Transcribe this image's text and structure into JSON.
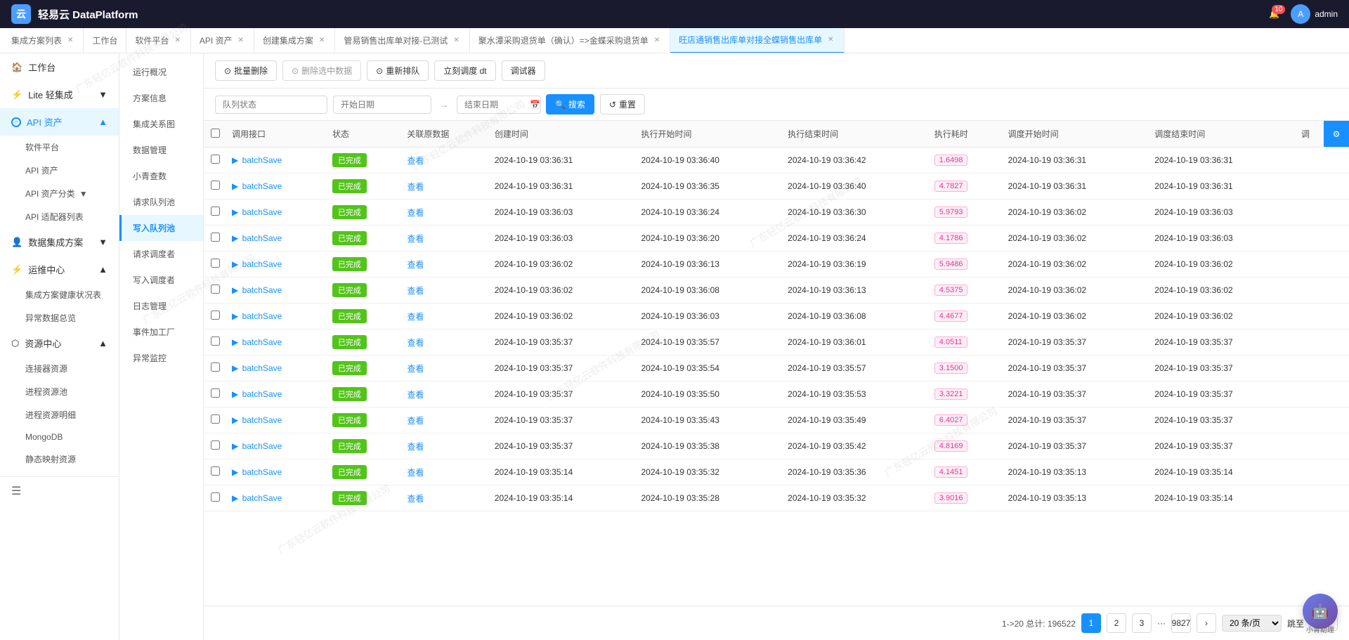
{
  "topbar": {
    "logo_text": "云",
    "title": "轻易云 DataPlatform",
    "notification_count": "10",
    "user_name": "admin"
  },
  "tabs": [
    {
      "id": "tab-solution-list",
      "label": "集成方案列表",
      "closable": true,
      "active": false
    },
    {
      "id": "tab-workbench",
      "label": "工作台",
      "closable": false,
      "active": false
    },
    {
      "id": "tab-software",
      "label": "软件平台",
      "closable": true,
      "active": false
    },
    {
      "id": "tab-api",
      "label": "API 资产",
      "closable": true,
      "active": false
    },
    {
      "id": "tab-create",
      "label": "创建集成方案",
      "closable": true,
      "active": false
    },
    {
      "id": "tab-sales",
      "label": "管易销售出库单对接-已测试",
      "closable": true,
      "active": false
    },
    {
      "id": "tab-purchase",
      "label": "聚水潭采购退货单（确认）=>金蝶采购退货单",
      "closable": true,
      "active": false
    },
    {
      "id": "tab-active",
      "label": "旺店通销售出库单对接全蝶销售出库单",
      "closable": true,
      "active": true
    }
  ],
  "sidebar": {
    "items": [
      {
        "id": "workbench",
        "label": "工作台",
        "icon": "🏠",
        "active": false,
        "expandable": false
      },
      {
        "id": "lite",
        "label": "Lite 轻集成",
        "icon": "⚡",
        "active": false,
        "expandable": true
      },
      {
        "id": "api-assets",
        "label": "API 资产",
        "icon": "○",
        "active": true,
        "expandable": true,
        "circle": true
      },
      {
        "id": "software-platform",
        "label": "软件平台",
        "sub": true,
        "active": false
      },
      {
        "id": "api-assets-sub",
        "label": "API 资产",
        "sub": true,
        "active": false
      },
      {
        "id": "api-classify",
        "label": "API 资产分类",
        "sub": true,
        "active": false,
        "expandable": true
      },
      {
        "id": "api-adapter",
        "label": "API 适配器列表",
        "sub": true,
        "active": false
      },
      {
        "id": "data-integration",
        "label": "数据集成方案",
        "icon": "👤",
        "active": false,
        "expandable": true
      },
      {
        "id": "operation-center",
        "label": "运维中心",
        "icon": "⚡",
        "active": false,
        "expandable": true,
        "expanded": true
      },
      {
        "id": "solution-health",
        "label": "集成方案健康状况表",
        "sub": true,
        "active": false
      },
      {
        "id": "exception-data",
        "label": "异常数据总览",
        "sub": true,
        "active": false
      },
      {
        "id": "resource-center",
        "label": "资源中心",
        "icon": "⬡",
        "active": false,
        "expandable": true,
        "expanded": true
      },
      {
        "id": "connector",
        "label": "连接器资源",
        "sub": true,
        "active": false
      },
      {
        "id": "process-pool",
        "label": "进程资源池",
        "sub": true,
        "active": false
      },
      {
        "id": "process-detail",
        "label": "进程资源明细",
        "sub": true,
        "active": false
      },
      {
        "id": "mongodb",
        "label": "MongoDB",
        "sub": true,
        "active": false
      },
      {
        "id": "static-mapping",
        "label": "静态映射资源",
        "sub": true,
        "active": false
      }
    ]
  },
  "left_nav": {
    "items": [
      {
        "id": "overview",
        "label": "运行概况",
        "active": false
      },
      {
        "id": "solution-info",
        "label": "方案信息",
        "active": false
      },
      {
        "id": "relation-graph",
        "label": "集成关系图",
        "active": false
      },
      {
        "id": "data-management",
        "label": "数据管理",
        "active": false
      },
      {
        "id": "small-green-count",
        "label": "小青查数",
        "active": false
      },
      {
        "id": "request-queue",
        "label": "请求队列池",
        "active": false
      },
      {
        "id": "write-queue",
        "label": "写入队列池",
        "active": true
      },
      {
        "id": "request-scheduler",
        "label": "请求调度者",
        "active": false
      },
      {
        "id": "write-scheduler",
        "label": "写入调度者",
        "active": false
      },
      {
        "id": "log-management",
        "label": "日志管理",
        "active": false
      },
      {
        "id": "event-factory",
        "label": "事件加工厂",
        "active": false
      },
      {
        "id": "exception-monitor",
        "label": "异常监控",
        "active": false
      }
    ]
  },
  "toolbar": {
    "batch_delete_label": "批量删除",
    "delete_selected_label": "删除选中数据",
    "reschedule_label": "重新排队",
    "schedule_dt_label": "立刻调度 dt",
    "debug_label": "调试器"
  },
  "filter": {
    "status_placeholder": "队列状态",
    "start_date_placeholder": "开始日期",
    "end_date_placeholder": "结束日期",
    "search_label": "搜索",
    "reset_label": "重置"
  },
  "table": {
    "columns": [
      "调用接口",
      "状态",
      "关联原数据",
      "创建时间",
      "执行开始时间",
      "执行结束时间",
      "执行耗时",
      "调度开始时间",
      "调度结束时间",
      "调"
    ],
    "rows": [
      {
        "interface": "batchSave",
        "status": "已完成",
        "related_data": "查看",
        "created_at": "2024-10-19 03:36:31",
        "exec_start": "2024-10-19 03:36:40",
        "exec_end": "2024-10-19 03:36:42",
        "exec_time": "1.6498",
        "sched_start": "2024-10-19 03:36:31",
        "sched_end": "2024-10-19 03:36:31"
      },
      {
        "interface": "batchSave",
        "status": "已完成",
        "related_data": "查看",
        "created_at": "2024-10-19 03:36:31",
        "exec_start": "2024-10-19 03:36:35",
        "exec_end": "2024-10-19 03:36:40",
        "exec_time": "4.7827",
        "sched_start": "2024-10-19 03:36:31",
        "sched_end": "2024-10-19 03:36:31"
      },
      {
        "interface": "batchSave",
        "status": "已完成",
        "related_data": "查看",
        "created_at": "2024-10-19 03:36:03",
        "exec_start": "2024-10-19 03:36:24",
        "exec_end": "2024-10-19 03:36:30",
        "exec_time": "5.9793",
        "sched_start": "2024-10-19 03:36:02",
        "sched_end": "2024-10-19 03:36:03"
      },
      {
        "interface": "batchSave",
        "status": "已完成",
        "related_data": "查看",
        "created_at": "2024-10-19 03:36:03",
        "exec_start": "2024-10-19 03:36:20",
        "exec_end": "2024-10-19 03:36:24",
        "exec_time": "4.1786",
        "sched_start": "2024-10-19 03:36:02",
        "sched_end": "2024-10-19 03:36:03"
      },
      {
        "interface": "batchSave",
        "status": "已完成",
        "related_data": "查看",
        "created_at": "2024-10-19 03:36:02",
        "exec_start": "2024-10-19 03:36:13",
        "exec_end": "2024-10-19 03:36:19",
        "exec_time": "5.9486",
        "sched_start": "2024-10-19 03:36:02",
        "sched_end": "2024-10-19 03:36:02"
      },
      {
        "interface": "batchSave",
        "status": "已完成",
        "related_data": "查看",
        "created_at": "2024-10-19 03:36:02",
        "exec_start": "2024-10-19 03:36:08",
        "exec_end": "2024-10-19 03:36:13",
        "exec_time": "4.5375",
        "sched_start": "2024-10-19 03:36:02",
        "sched_end": "2024-10-19 03:36:02"
      },
      {
        "interface": "batchSave",
        "status": "已完成",
        "related_data": "查看",
        "created_at": "2024-10-19 03:36:02",
        "exec_start": "2024-10-19 03:36:03",
        "exec_end": "2024-10-19 03:36:08",
        "exec_time": "4.4677",
        "sched_start": "2024-10-19 03:36:02",
        "sched_end": "2024-10-19 03:36:02"
      },
      {
        "interface": "batchSave",
        "status": "已完成",
        "related_data": "查看",
        "created_at": "2024-10-19 03:35:37",
        "exec_start": "2024-10-19 03:35:57",
        "exec_end": "2024-10-19 03:36:01",
        "exec_time": "4.0511",
        "sched_start": "2024-10-19 03:35:37",
        "sched_end": "2024-10-19 03:35:37"
      },
      {
        "interface": "batchSave",
        "status": "已完成",
        "related_data": "查看",
        "created_at": "2024-10-19 03:35:37",
        "exec_start": "2024-10-19 03:35:54",
        "exec_end": "2024-10-19 03:35:57",
        "exec_time": "3.1500",
        "sched_start": "2024-10-19 03:35:37",
        "sched_end": "2024-10-19 03:35:37"
      },
      {
        "interface": "batchSave",
        "status": "已完成",
        "related_data": "查看",
        "created_at": "2024-10-19 03:35:37",
        "exec_start": "2024-10-19 03:35:50",
        "exec_end": "2024-10-19 03:35:53",
        "exec_time": "3.3221",
        "sched_start": "2024-10-19 03:35:37",
        "sched_end": "2024-10-19 03:35:37"
      },
      {
        "interface": "batchSave",
        "status": "已完成",
        "related_data": "查看",
        "created_at": "2024-10-19 03:35:37",
        "exec_start": "2024-10-19 03:35:43",
        "exec_end": "2024-10-19 03:35:49",
        "exec_time": "6.4027",
        "sched_start": "2024-10-19 03:35:37",
        "sched_end": "2024-10-19 03:35:37"
      },
      {
        "interface": "batchSave",
        "status": "已完成",
        "related_data": "查看",
        "created_at": "2024-10-19 03:35:37",
        "exec_start": "2024-10-19 03:35:38",
        "exec_end": "2024-10-19 03:35:42",
        "exec_time": "4.8169",
        "sched_start": "2024-10-19 03:35:37",
        "sched_end": "2024-10-19 03:35:37"
      },
      {
        "interface": "batchSave",
        "status": "已完成",
        "related_data": "查看",
        "created_at": "2024-10-19 03:35:14",
        "exec_start": "2024-10-19 03:35:32",
        "exec_end": "2024-10-19 03:35:36",
        "exec_time": "4.1451",
        "sched_start": "2024-10-19 03:35:13",
        "sched_end": "2024-10-19 03:35:14"
      },
      {
        "interface": "batchSave",
        "status": "已完成",
        "related_data": "查看",
        "created_at": "2024-10-19 03:35:14",
        "exec_start": "2024-10-19 03:35:28",
        "exec_end": "2024-10-19 03:35:32",
        "exec_time": "3.9016",
        "sched_start": "2024-10-19 03:35:13",
        "sched_end": "2024-10-19 03:35:14"
      }
    ]
  },
  "pagination": {
    "info": "1->20 总计: 196522",
    "pages": [
      "1",
      "2",
      "3",
      "...",
      "9827"
    ],
    "page_size": "20 条/页",
    "jump_label": "跳至"
  },
  "floating_assistant": {
    "label": "小青助理"
  }
}
